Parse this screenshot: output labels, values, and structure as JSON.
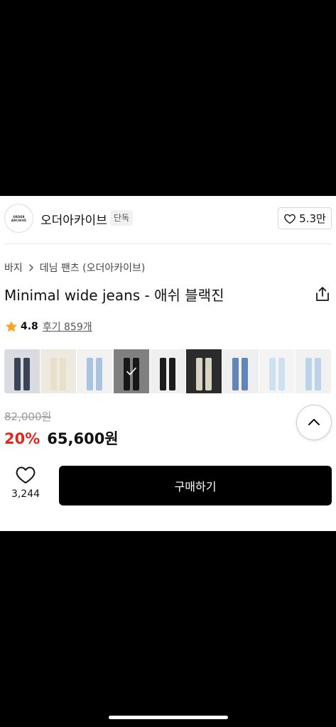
{
  "brand": {
    "logo_text": [
      "ORDER",
      "ARCHIVE"
    ],
    "name": "오더아카이브",
    "badge": "단독",
    "like_count": "5.3만"
  },
  "breadcrumb": {
    "items": [
      "바지",
      "데님 팬츠 (오더아카이브)"
    ]
  },
  "product": {
    "title": "Minimal wide jeans - 애쉬 블랙진",
    "rating": "4.8",
    "reviews": "후기 859개"
  },
  "color_options": [
    {
      "pants": "#3a4456",
      "bg": "#d9dbe0"
    },
    {
      "pants": "#e8e0c8",
      "bg": "#eeeae2"
    },
    {
      "pants": "#a9c4de",
      "bg": "#f2f2f2"
    },
    {
      "pants": "#2a2a2a",
      "bg": "#e9e9e9",
      "selected": true
    },
    {
      "pants": "#1c1c1c",
      "bg": "#efefef"
    },
    {
      "pants": "#d8d3c3",
      "bg": "#2b2b2b"
    },
    {
      "pants": "#5f86b4",
      "bg": "#efefef"
    },
    {
      "pants": "#cfe0ee",
      "bg": "#f4f4f4"
    },
    {
      "pants": "#bcd3ea",
      "bg": "#f1f1f1"
    }
  ],
  "price": {
    "original": "82,000원",
    "discount": "20%",
    "sale": "65,600원"
  },
  "bottom": {
    "wish_count": "3,244",
    "buy_label": "구매하기"
  },
  "colors": {
    "discount": "#e1261c",
    "star": "#f5a623",
    "buy_button": "#000000"
  }
}
